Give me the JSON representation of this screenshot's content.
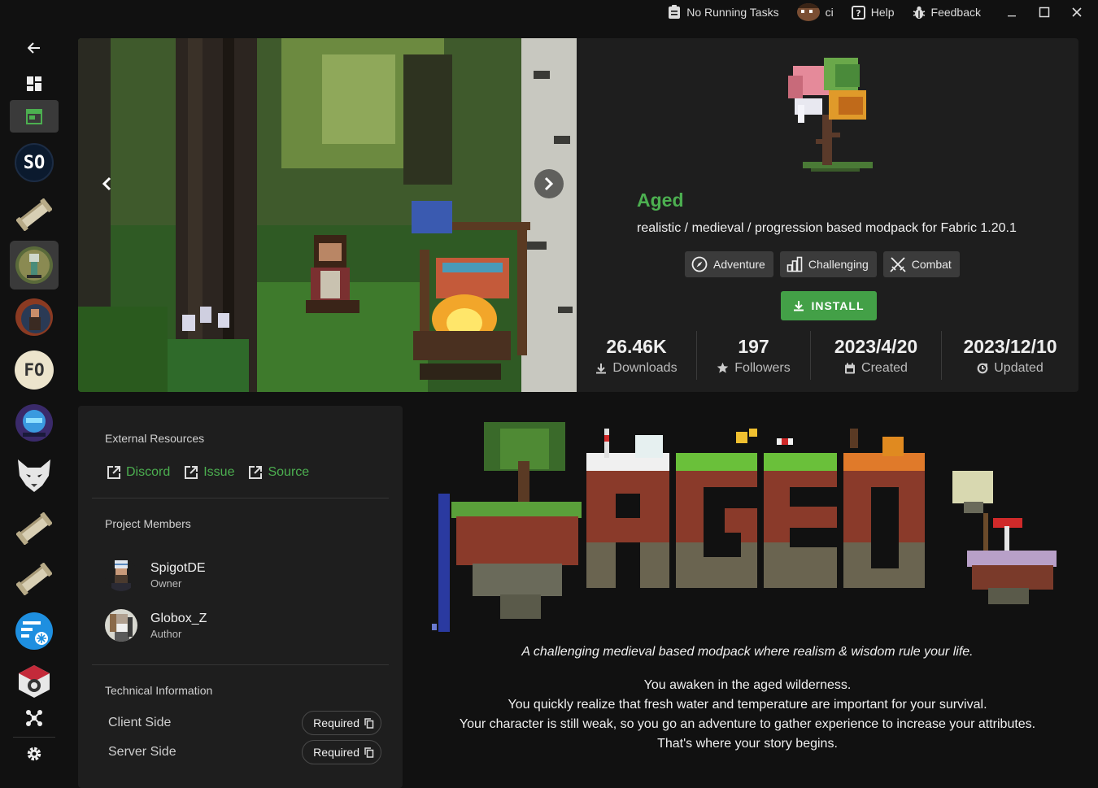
{
  "titlebar": {
    "tasks": "No Running Tasks",
    "user": "ci",
    "help": "Help",
    "feedback": "Feedback"
  },
  "sidebar": {
    "instances": [
      "SO",
      "FO"
    ]
  },
  "project": {
    "name": "Aged",
    "description": "realistic / medieval / progression based modpack for Fabric 1.20.1",
    "tags": [
      "Adventure",
      "Challenging",
      "Combat"
    ],
    "install_label": "INSTALL",
    "stats": [
      {
        "value": "26.46K",
        "label": "Downloads",
        "icon": "download-icon"
      },
      {
        "value": "197",
        "label": "Followers",
        "icon": "star-icon"
      },
      {
        "value": "2023/4/20",
        "label": "Created",
        "icon": "calendar-icon"
      },
      {
        "value": "2023/12/10",
        "label": "Updated",
        "icon": "update-icon"
      }
    ]
  },
  "external": {
    "title": "External Resources",
    "links": [
      "Discord",
      "Issue",
      "Source"
    ]
  },
  "members": {
    "title": "Project Members",
    "list": [
      {
        "name": "SpigotDE",
        "role": "Owner"
      },
      {
        "name": "Globox_Z",
        "role": "Author"
      }
    ]
  },
  "technical": {
    "title": "Technical Information",
    "rows": [
      {
        "label": "Client Side",
        "value": "Required"
      },
      {
        "label": "Server Side",
        "value": "Required"
      }
    ]
  },
  "body": {
    "tagline": "A challenging medieval based modpack where realism & wisdom rule your life.",
    "paragraphs": [
      "You awaken in the aged wilderness.",
      "You quickly realize that fresh water and temperature are important for your survival.",
      "Your character is still weak, so you go an adventure to gather experience to increase your attributes.",
      "That's where your story begins."
    ]
  },
  "colors": {
    "accent": "#4caf50",
    "install": "#43a047",
    "panel": "#1e1e1e",
    "background": "#111111"
  }
}
